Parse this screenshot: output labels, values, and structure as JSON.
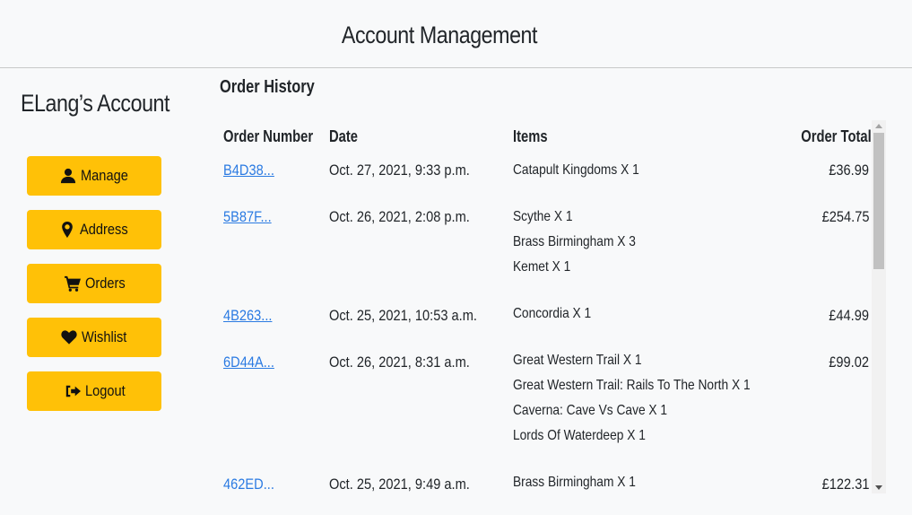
{
  "header": {
    "title": "Account Management"
  },
  "sidebar": {
    "account_title": "ELang’s Account",
    "items": [
      {
        "label": "Manage",
        "icon": "user-icon"
      },
      {
        "label": "Address",
        "icon": "map-marker-icon"
      },
      {
        "label": "Orders",
        "icon": "shopping-cart-icon"
      },
      {
        "label": "Wishlist",
        "icon": "heart-icon"
      },
      {
        "label": "Logout",
        "icon": "sign-out-icon"
      }
    ],
    "accent": "#ffc107"
  },
  "orders": {
    "title": "Order History",
    "columns": [
      "Order Number",
      "Date",
      "Items",
      "Order Total"
    ],
    "rows": [
      {
        "number": "B4D38...",
        "date": "Oct. 27, 2021, 9:33 p.m.",
        "items": [
          "Catapult Kingdoms X 1"
        ],
        "total": "£36.99"
      },
      {
        "number": "5B87F...",
        "date": "Oct. 26, 2021, 2:08 p.m.",
        "items": [
          "Scythe X 1",
          "Brass Birmingham X 3",
          "Kemet X 1"
        ],
        "total": "£254.75"
      },
      {
        "number": "4B263...",
        "date": "Oct. 25, 2021, 10:53 a.m.",
        "items": [
          "Concordia X 1"
        ],
        "total": "£44.99"
      },
      {
        "number": "6D44A...",
        "date": "Oct. 26, 2021, 8:31 a.m.",
        "items": [
          "Great Western Trail X 1",
          "Great Western Trail: Rails To The North X 1",
          "Caverna: Cave Vs Cave X 1",
          "Lords Of Waterdeep X 1"
        ],
        "total": "£99.02"
      },
      {
        "number": "462ED...",
        "date": "Oct. 25, 2021, 9:49 a.m.",
        "items": [
          "Brass Birmingham X 1"
        ],
        "total": "£122.31"
      }
    ],
    "link_color": "#2a7ae2"
  }
}
